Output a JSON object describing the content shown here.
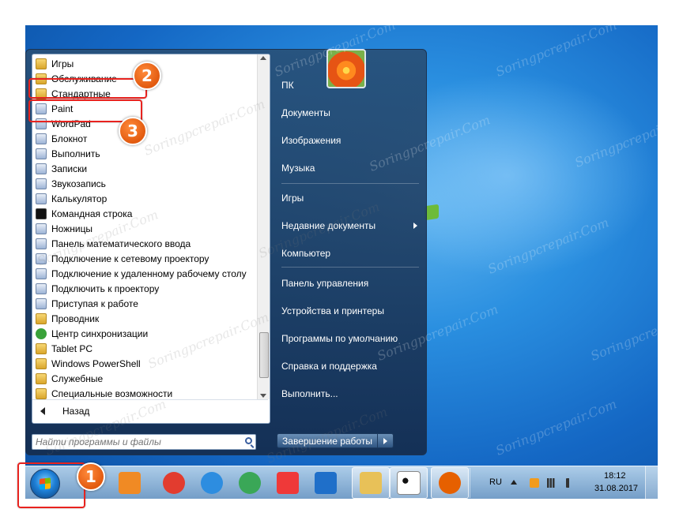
{
  "start_menu": {
    "programs": [
      {
        "label": "Игры",
        "icon": "folder-icon"
      },
      {
        "label": "Обслуживание",
        "icon": "folder-icon"
      },
      {
        "label": "Стандартные",
        "icon": "folder-icon"
      },
      {
        "label": "Paint",
        "icon": "paint-icon"
      },
      {
        "label": "WordPad",
        "icon": "wordpad-icon"
      },
      {
        "label": "Блокнот",
        "icon": "notepad-icon"
      },
      {
        "label": "Выполнить",
        "icon": "run-icon"
      },
      {
        "label": "Записки",
        "icon": "sticky-notes-icon"
      },
      {
        "label": "Звукозапись",
        "icon": "microphone-icon"
      },
      {
        "label": "Калькулятор",
        "icon": "calculator-icon"
      },
      {
        "label": "Командная строка",
        "icon": "cmd-icon"
      },
      {
        "label": "Ножницы",
        "icon": "scissors-icon"
      },
      {
        "label": "Панель математического ввода",
        "icon": "math-input-icon"
      },
      {
        "label": "Подключение к сетевому проектору",
        "icon": "network-projector-icon"
      },
      {
        "label": "Подключение к удаленному рабочему столу",
        "icon": "remote-desktop-icon"
      },
      {
        "label": "Подключить к проектору",
        "icon": "projector-icon"
      },
      {
        "label": "Приступая к работе",
        "icon": "getting-started-icon"
      },
      {
        "label": "Проводник",
        "icon": "explorer-icon"
      },
      {
        "label": "Центр синхронизации",
        "icon": "sync-center-icon"
      },
      {
        "label": "Tablet PC",
        "icon": "folder-icon"
      },
      {
        "label": "Windows PowerShell",
        "icon": "folder-icon"
      },
      {
        "label": "Служебные",
        "icon": "folder-icon"
      },
      {
        "label": "Специальные возможности",
        "icon": "folder-icon"
      }
    ],
    "back_label": "Назад",
    "search_placeholder": "Найти программы и файлы",
    "right_items": [
      {
        "label": "ПК"
      },
      {
        "label": "Документы"
      },
      {
        "label": "Изображения"
      },
      {
        "label": "Музыка"
      },
      {
        "label": "Игры"
      },
      {
        "label": "Недавние документы",
        "has_submenu": true
      },
      {
        "label": "Компьютер"
      },
      {
        "label": "Панель управления"
      },
      {
        "label": "Устройства и принтеры"
      },
      {
        "label": "Программы по умолчанию"
      },
      {
        "label": "Справка и поддержка"
      },
      {
        "label": "Выполнить..."
      }
    ],
    "shutdown_label": "Завершение работы"
  },
  "taskbar": {
    "pinned": [
      {
        "name": "windows-media-center-icon",
        "color": "#f08a24"
      },
      {
        "name": "yandex-browser-icon",
        "color": "#e23c2f"
      },
      {
        "name": "internet-explorer-icon",
        "color": "#2d8de0"
      },
      {
        "name": "chrome-icon",
        "color": "#3aa757"
      },
      {
        "name": "vivaldi-icon",
        "color": "#ef3939"
      },
      {
        "name": "maxthon-icon",
        "color": "#1f6fc9"
      },
      {
        "name": "file-explorer-icon",
        "color": "#e8c158"
      },
      {
        "name": "panda-icon",
        "color": "#ffffff"
      },
      {
        "name": "firefox-icon",
        "color": "#e66000"
      }
    ],
    "language": "RU",
    "time": "18:12",
    "date": "31.08.2017"
  },
  "callouts": [
    "1",
    "2",
    "3"
  ],
  "watermark": "Soringpcrepair.Com"
}
